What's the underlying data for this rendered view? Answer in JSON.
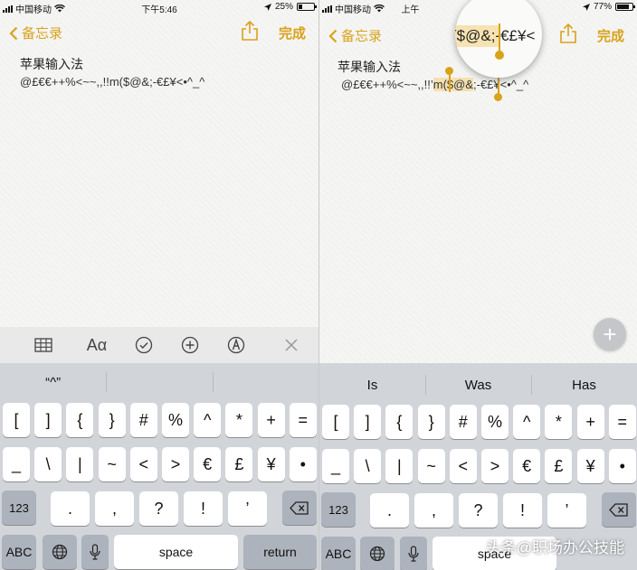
{
  "colors": {
    "accent": "#d9a21b",
    "paper": "#f5f5f3",
    "keyboard_bg": "#d1d4d9",
    "key": "#ffffff",
    "key_dark": "#adb3bc"
  },
  "left": {
    "status": {
      "carrier": "中国移动",
      "time": "下午5:46",
      "battery": "25%",
      "battery_level": 0.25
    },
    "nav": {
      "back_label": "备忘录",
      "done_label": "完成"
    },
    "note": {
      "title": "苹果输入法",
      "text": "@£€€++%<~~,,!!m($@&;-€£¥<•^_^"
    },
    "toolbar": {
      "icons": [
        "table-icon",
        "text-format-icon",
        "checklist-icon",
        "add-icon",
        "markup-icon",
        "close-icon"
      ],
      "format_label": "Aα"
    },
    "predictions": [
      "“^”",
      "",
      ""
    ],
    "keys": {
      "row1": [
        "[",
        "]",
        "{",
        "}",
        "#",
        "%",
        "^",
        "*",
        "+",
        "="
      ],
      "row2": [
        "_",
        "\\",
        "|",
        "~",
        "<",
        ">",
        "€",
        "£",
        "¥",
        "•"
      ],
      "row3": [
        ".",
        ",",
        "?",
        "!",
        "’"
      ],
      "numbers": "123",
      "abc": "ABC",
      "space": "space",
      "return": "return"
    }
  },
  "right": {
    "status": {
      "carrier": "中国移动",
      "time": "上午",
      "battery": "77%",
      "battery_level": 0.77
    },
    "nav": {
      "back_label": "备忘录",
      "done_label": "完成"
    },
    "magnifier_text": "($@&;-€£¥<",
    "note": {
      "title": "苹果输入法",
      "text_before": "@£€€++%<~~,,!!’",
      "text_selected": "m($@&",
      "text_after": ";-€£¥<•^_^"
    },
    "predictions": [
      "Is",
      "Was",
      "Has"
    ],
    "keys": {
      "row1": [
        "[",
        "]",
        "{",
        "}",
        "#",
        "%",
        "^",
        "*",
        "+",
        "="
      ],
      "row2": [
        "_",
        "\\",
        "|",
        "~",
        "<",
        ">",
        "€",
        "£",
        "¥",
        "•"
      ],
      "row3": [
        ".",
        ",",
        "?",
        "!",
        "’"
      ],
      "numbers": "123",
      "abc": "ABC",
      "space": "space"
    },
    "fab_label": "+"
  },
  "watermark": "头条@职场办公技能"
}
